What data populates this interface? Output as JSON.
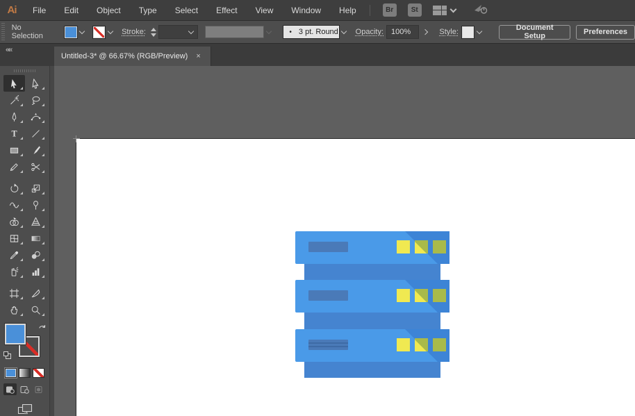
{
  "theme": {
    "--menubar-bg": "#3e3e3e",
    "--controlbar-bg": "#4d4d4d",
    "--strip-bg": "#3b3b3b",
    "--tab-bg": "#515151",
    "--panel-bg": "#4d4d4d",
    "--pasteboard": "#5f5f5f",
    "--field-bg": "#3f3f3f",
    "--text": "#d9d9d9",
    "--logo": "#c17a45",
    "--accent-fill": "#4a90d9",
    "--srv-body": "#4a9ae8",
    "--srv-shadow": "#3d84d6",
    "--srv-conn": "#4584d0",
    "--srv-slot": "#4a7ab8",
    "--led-yellow": "#f0e951",
    "--led-olive": "#a9ba4a"
  },
  "menu_bar": {
    "logo": "Ai",
    "items": [
      "File",
      "Edit",
      "Object",
      "Type",
      "Select",
      "Effect",
      "View",
      "Window",
      "Help"
    ],
    "bridge_label": "Br",
    "stock_label": "St"
  },
  "control_bar": {
    "selection_status": "No Selection",
    "stroke_label": "Stroke:",
    "brush_dot": "•",
    "brush_name": "3 pt. Round",
    "opacity_label": "Opacity:",
    "opacity_value": "100%",
    "style_label": "Style:",
    "document_setup_label": "Document Setup",
    "preferences_label": "Preferences"
  },
  "tab_strip": {
    "collapse_glyph": "««",
    "document_title": "Untitled-3* @ 66.67% (RGB/Preview)",
    "close_glyph": "×"
  },
  "tools": {
    "active_tool": "selection-tool",
    "names": [
      "selection-tool",
      "direct-selection-tool",
      "magic-wand-tool",
      "lasso-tool",
      "pen-tool",
      "curvature-tool",
      "type-tool",
      "line-segment-tool",
      "rectangle-tool",
      "paintbrush-tool",
      "shaper-tool",
      "scissors-tool",
      "rotate-tool",
      "scale-tool",
      "width-tool",
      "free-transform-tool",
      "shape-builder-tool",
      "perspective-grid-tool",
      "mesh-tool",
      "gradient-tool",
      "eyedropper-tool",
      "blend-tool",
      "symbol-sprayer-tool",
      "column-graph-tool",
      "artboard-tool",
      "slice-tool",
      "hand-tool",
      "zoom-tool"
    ],
    "type_tool_glyph": "T",
    "fill_color": "#4a90d9",
    "stroke_color": "none"
  },
  "canvas": {
    "artboard_color": "#ffffff",
    "illustration": {
      "name": "server-stack",
      "units": 3,
      "leds_per_unit": 3,
      "body_color": "#4a9ae8",
      "shadow_color": "#3d84d6",
      "connector_color": "#4584d0",
      "slot_color": "#4a7ab8",
      "led_colors": [
        "#f0e951",
        "#f0e951/#a9ba4a",
        "#a9ba4a"
      ]
    }
  }
}
